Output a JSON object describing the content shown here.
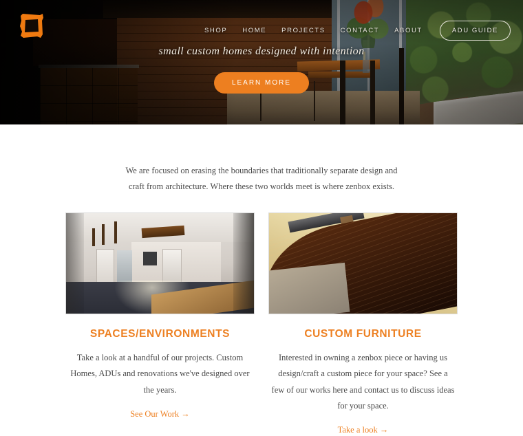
{
  "site": {
    "brand_name": "zenbox",
    "accent_color": "#ED7F20",
    "heading_color": "#ED8022",
    "logo_icon": "orange-hand-drawn-square-logo"
  },
  "hero": {
    "tagline": "small custom homes designed with intention",
    "cta_label": "LEARN MORE",
    "background_image": "dark-modern-home-interior-with-wood-wall-glass-doors-and-garden",
    "nav": {
      "items": [
        {
          "label": "SHOP"
        },
        {
          "label": "HOME"
        },
        {
          "label": "PROJECTS"
        },
        {
          "label": "CONTACT"
        },
        {
          "label": "ABOUT"
        }
      ],
      "button_label": "ADU GUIDE"
    }
  },
  "main": {
    "intro": "We are focused on erasing the boundaries that traditionally separate design and craft from architecture.  Where these two worlds meet is where zenbox exists.",
    "cards": [
      {
        "title": "SPACES/ENVIRONMENTS",
        "body": "Take a look at a handful of our projects. Custom Homes, ADUs and renovations we've designed over the years.",
        "link_label": "See Our Work →",
        "image_alt": "modern-interior-dining-room-with-pendant-lights-and-wood-table"
      },
      {
        "title": "CUSTOM FURNITURE",
        "body": "Interested in owning a zenbox piece or having us design/craft a custom piece for your space? See a few of our works here and contact us to discuss ideas for your space.",
        "link_label": "Take a look →",
        "image_alt": "live-edge-dark-walnut-wood-slab-furniture-closeup"
      }
    ]
  }
}
